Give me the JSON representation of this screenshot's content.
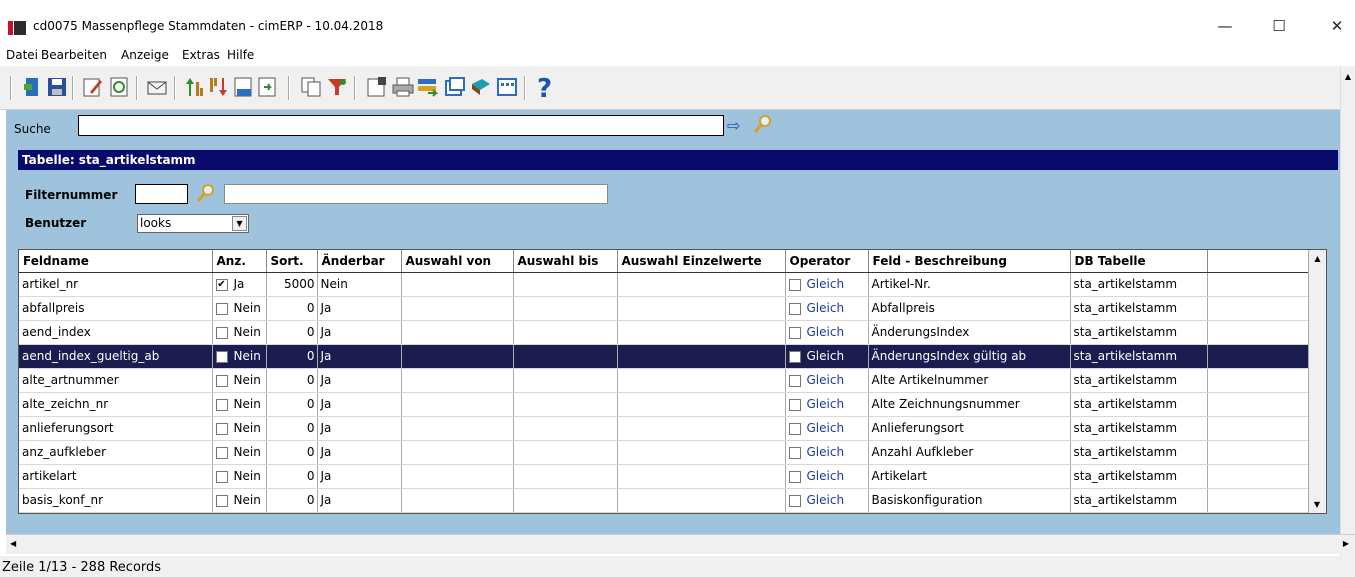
{
  "window": {
    "title": "cd0075 Massenpflege Stammdaten - cimERP - 10.04.2018",
    "minimize": "—",
    "maximize": "☐",
    "close": "✕"
  },
  "menu": [
    "Datei",
    "Bearbeiten",
    "Anzeige",
    "Extras",
    "Hilfe"
  ],
  "toolbar_icons": [
    "exit-icon",
    "save-icon",
    "edit-icon",
    "refresh-icon",
    "mail-icon",
    "sort-asc-icon",
    "sort-desc-icon",
    "numbering-icon",
    "export-icon",
    "copy-icon",
    "filter-icon",
    "properties-icon",
    "print-icon",
    "transfer-icon",
    "window-icon",
    "book-icon",
    "grid-icon",
    "help-icon"
  ],
  "search": {
    "label": "Suche",
    "value": ""
  },
  "table_title": "Tabelle: sta_artikelstamm",
  "filter": {
    "label": "Filternummer",
    "value": "",
    "description": ""
  },
  "user": {
    "label": "Benutzer",
    "value": "looks"
  },
  "grid": {
    "columns": [
      "Feldname",
      "Anz.",
      "Sort.",
      "Änderbar",
      "Auswahl von",
      "Auswahl bis",
      "Auswahl Einzelwerte",
      "Operator",
      "Feld - Beschreibung",
      "DB Tabelle",
      ""
    ],
    "rows": [
      {
        "feldname": "artikel_nr",
        "anz": "Ja",
        "anz_checked": true,
        "sort": "5000",
        "aenderbar": "Nein",
        "operator": "Gleich",
        "beschreibung": "Artikel-Nr.",
        "db": "sta_artikelstamm"
      },
      {
        "feldname": "abfallpreis",
        "anz": "Nein",
        "anz_checked": false,
        "sort": "0",
        "aenderbar": "Ja",
        "operator": "Gleich",
        "beschreibung": "Abfallpreis",
        "db": "sta_artikelstamm"
      },
      {
        "feldname": "aend_index",
        "anz": "Nein",
        "anz_checked": false,
        "sort": "0",
        "aenderbar": "Ja",
        "operator": "Gleich",
        "beschreibung": "ÄnderungsIndex",
        "db": "sta_artikelstamm"
      },
      {
        "feldname": "aend_index_gueltig_ab",
        "anz": "Nein",
        "anz_checked": false,
        "sort": "0",
        "aenderbar": "Ja",
        "operator": "Gleich",
        "beschreibung": "ÄnderungsIndex gültig ab",
        "db": "sta_artikelstamm",
        "selected": true
      },
      {
        "feldname": "alte_artnummer",
        "anz": "Nein",
        "anz_checked": false,
        "sort": "0",
        "aenderbar": "Ja",
        "operator": "Gleich",
        "beschreibung": "Alte Artikelnummer",
        "db": "sta_artikelstamm"
      },
      {
        "feldname": "alte_zeichn_nr",
        "anz": "Nein",
        "anz_checked": false,
        "sort": "0",
        "aenderbar": "Ja",
        "operator": "Gleich",
        "beschreibung": "Alte Zeichnungsnummer",
        "db": "sta_artikelstamm"
      },
      {
        "feldname": "anlieferungsort",
        "anz": "Nein",
        "anz_checked": false,
        "sort": "0",
        "aenderbar": "Ja",
        "operator": "Gleich",
        "beschreibung": "Anlieferungsort",
        "db": "sta_artikelstamm"
      },
      {
        "feldname": "anz_aufkleber",
        "anz": "Nein",
        "anz_checked": false,
        "sort": "0",
        "aenderbar": "Ja",
        "operator": "Gleich",
        "beschreibung": "Anzahl Aufkleber",
        "db": "sta_artikelstamm"
      },
      {
        "feldname": "artikelart",
        "anz": "Nein",
        "anz_checked": false,
        "sort": "0",
        "aenderbar": "Ja",
        "operator": "Gleich",
        "beschreibung": "Artikelart",
        "db": "sta_artikelstamm"
      },
      {
        "feldname": "basis_konf_nr",
        "anz": "Nein",
        "anz_checked": false,
        "sort": "0",
        "aenderbar": "Ja",
        "operator": "Gleich",
        "beschreibung": "Basiskonfiguration",
        "db": "sta_artikelstamm"
      }
    ]
  },
  "status": "Zeile 1/13 - 288 Records",
  "colors": {
    "panel": "#9fc3dd",
    "header": "#0a0a6b",
    "selected": "#1c1c50"
  }
}
